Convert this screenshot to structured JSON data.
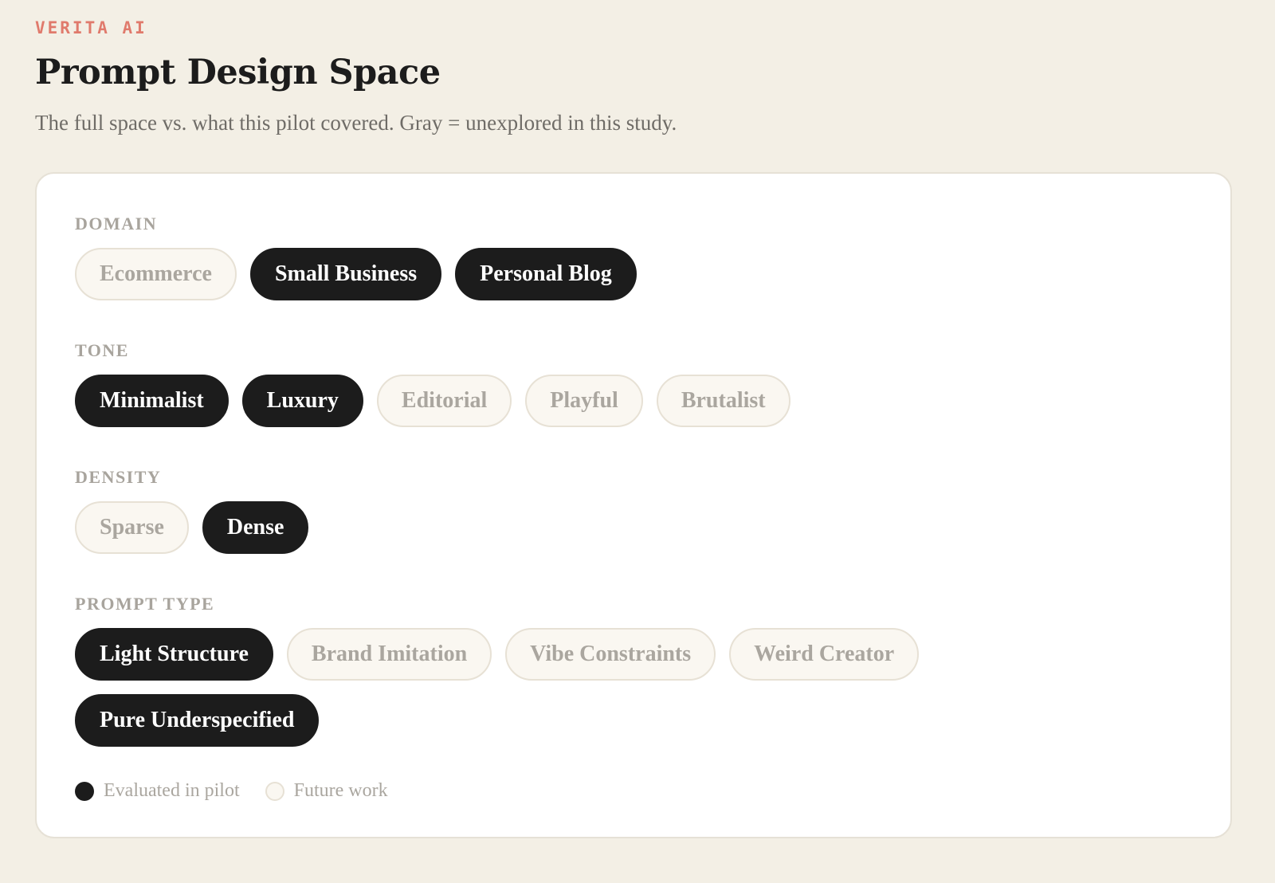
{
  "header": {
    "brand": "VERITA AI",
    "title": "Prompt Design Space",
    "subtitle": "The full space vs. what this pilot covered. Gray = unexplored in this study."
  },
  "sections": [
    {
      "label": "DOMAIN",
      "chips": [
        {
          "label": "Ecommerce",
          "evaluated": false
        },
        {
          "label": "Small Business",
          "evaluated": true
        },
        {
          "label": "Personal Blog",
          "evaluated": true
        }
      ]
    },
    {
      "label": "TONE",
      "chips": [
        {
          "label": "Minimalist",
          "evaluated": true
        },
        {
          "label": "Luxury",
          "evaluated": true
        },
        {
          "label": "Editorial",
          "evaluated": false
        },
        {
          "label": "Playful",
          "evaluated": false
        },
        {
          "label": "Brutalist",
          "evaluated": false
        }
      ]
    },
    {
      "label": "DENSITY",
      "chips": [
        {
          "label": "Sparse",
          "evaluated": false
        },
        {
          "label": "Dense",
          "evaluated": true
        }
      ]
    },
    {
      "label": "PROMPT TYPE",
      "chips": [
        {
          "label": "Light Structure",
          "evaluated": true
        },
        {
          "label": "Brand Imitation",
          "evaluated": false
        },
        {
          "label": "Vibe Constraints",
          "evaluated": false
        },
        {
          "label": "Weird Creator",
          "evaluated": false
        },
        {
          "label": "Pure Underspecified",
          "evaluated": true
        }
      ]
    }
  ],
  "legend": {
    "evaluated_label": "Evaluated in pilot",
    "future_label": "Future work"
  },
  "colors": {
    "background": "#f3efe5",
    "brand_accent": "#e07a6c",
    "chip_on": "#1c1c1c",
    "chip_off_bg": "#faf7f1",
    "chip_off_text": "#aaa69f"
  }
}
